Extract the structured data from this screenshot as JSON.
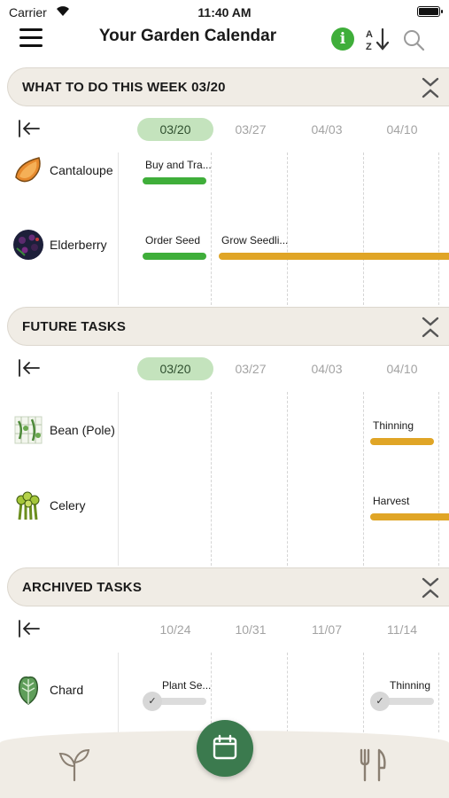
{
  "status_bar": {
    "carrier": "Carrier",
    "time": "11:40 AM"
  },
  "header": {
    "title": "Your Garden Calendar"
  },
  "icons": {
    "menu": "hamburger-menu-icon",
    "info": "info-icon",
    "sort": "sort-az-icon",
    "search": "search-icon",
    "collapse": "collapse-chevrons-icon",
    "back": "jump-to-start-icon",
    "calendar": "calendar-icon",
    "garden": "plant-sprout-icon",
    "harvest": "fork-knife-icon"
  },
  "colors": {
    "accent_green": "#3fae3a",
    "task_orange": "#e0a526",
    "active_date": "#c4e3bd",
    "fab": "#3b7a4e",
    "panel_beige": "#f0ece5"
  },
  "info_glyph": "i",
  "check_glyph": "✓",
  "sections": {
    "week": {
      "title": "WHAT TO DO THIS WEEK 03/20",
      "dates": [
        "03/20",
        "03/27",
        "04/03",
        "04/10"
      ],
      "active_date": "03/20",
      "rows": [
        {
          "plant": "Cantaloupe",
          "tasks": [
            {
              "label": "Buy and Tra...",
              "status": "green"
            }
          ]
        },
        {
          "plant": "Elderberry",
          "tasks": [
            {
              "label": "Order Seed",
              "status": "green"
            },
            {
              "label": "Grow Seedli...",
              "status": "orange"
            }
          ]
        }
      ]
    },
    "future": {
      "title": "FUTURE TASKS",
      "dates": [
        "03/20",
        "03/27",
        "04/03",
        "04/10"
      ],
      "active_date": "03/20",
      "rows": [
        {
          "plant": "Bean (Pole)",
          "tasks": [
            {
              "label": "Thinning",
              "status": "orange"
            }
          ]
        },
        {
          "plant": "Celery",
          "tasks": [
            {
              "label": "Harvest",
              "status": "orange"
            }
          ]
        }
      ]
    },
    "archived": {
      "title": "ARCHIVED TASKS",
      "dates": [
        "10/24",
        "10/31",
        "11/07",
        "11/14"
      ],
      "rows": [
        {
          "plant": "Chard",
          "tasks": [
            {
              "label": "Plant Se...",
              "status": "done"
            },
            {
              "label": "Thinning",
              "status": "done"
            }
          ]
        }
      ]
    }
  }
}
